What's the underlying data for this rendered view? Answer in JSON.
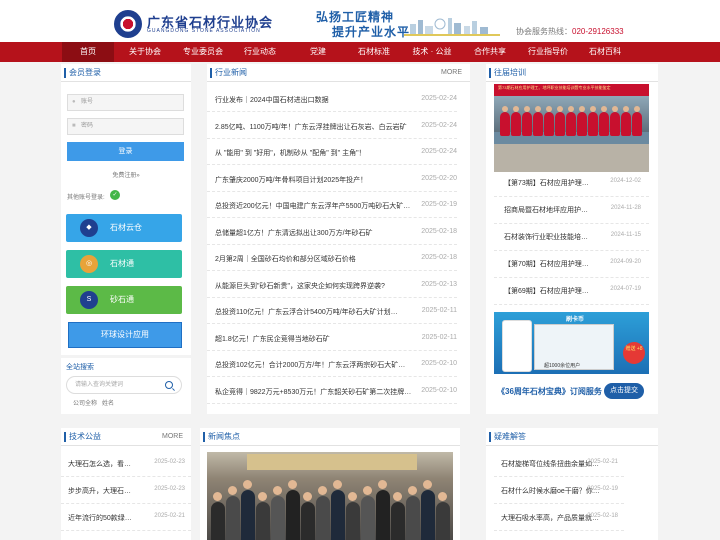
{
  "header": {
    "logo_text": "广东省石材行业协会",
    "logo_sub": "GUANGDONG STONE ASSOCIATION",
    "slogan_1": "弘扬工匠精神",
    "slogan_2": "提升产业水平",
    "hotline_label": "协会服务热线：",
    "hotline_number": "020-29126333"
  },
  "nav": {
    "items": [
      "首页",
      "关于协会",
      "专业委员会",
      "行业动态",
      "党建",
      "石材标准",
      "技术 · 公益",
      "合作共享",
      "行业指导价",
      "石材百科"
    ]
  },
  "login": {
    "title": "会员登录",
    "username_placeholder": "账号",
    "password_placeholder": "密码",
    "login_button": "登录",
    "register": "免费注册»",
    "other_login": "其他账号登录:",
    "wechat_glyph": "✓"
  },
  "apps": {
    "cloud": "石材云仓",
    "tong": "石材通",
    "sand": "砂石通",
    "env": "环球设计应用"
  },
  "site_search": {
    "title": "全站搜索",
    "placeholder": "请输入查询关键词",
    "option_1": "公司全称",
    "option_2": "姓名"
  },
  "industry_news": {
    "title": "行业新闻",
    "more": "MORE",
    "items": [
      {
        "title": "行业发布｜2024中国石材进出口数据",
        "date": "2025-02-24"
      },
      {
        "title": "2.85亿吨、1100万吨/年！广东云浮挂牌出让石灰岩、白云岩矿",
        "date": "2025-02-24"
      },
      {
        "title": "从 \"能用\" 到 \"好用\"，机制砂从 \"配角\" 到\" 主角\"！",
        "date": "2025-02-24"
      },
      {
        "title": "广东肇庆2000万吨/年骨料项目计划2025年投产！",
        "date": "2025-02-20"
      },
      {
        "title": "总投资近200亿元！中国电建广东云浮年产5500万吨砂石大矿…",
        "date": "2025-02-19"
      },
      {
        "title": "总储量超1亿方！广东清远拟出让300万方/年砂石矿",
        "date": "2025-02-18"
      },
      {
        "title": "2月第2周｜全国砂石均价和部分区域砂石价格",
        "date": "2025-02-18"
      },
      {
        "title": "从能源巨头到\"砂石新贵\"，这家央企如何实现跨界逆袭?",
        "date": "2025-02-13"
      },
      {
        "title": "总投资110亿元！广东云浮合计5400万吨/年砂石大矿计划…",
        "date": "2025-02-11"
      },
      {
        "title": "超1.8亿元！广东民企竞得当地砂石矿",
        "date": "2025-02-11"
      },
      {
        "title": "总投资102亿元！合计2000万方/年！广东云浮两宗砂石大矿…",
        "date": "2025-02-10"
      },
      {
        "title": "私企竞得｜9822万元+8530万元！广东韶关砂石矿第二次挂牌…",
        "date": "2025-02-10"
      }
    ]
  },
  "training": {
    "title": "往届培训",
    "photo_banner": "第73期石材应用护理工、地坪职业技能培训暨专业水平技能鉴定",
    "items": [
      {
        "title": "【第73期】石材应用护理…",
        "date": "2024-12-02"
      },
      {
        "title": "招商局暨石材地坪应用护…",
        "date": "2024-11-28"
      },
      {
        "title": "石材装饰行业职业技能培…",
        "date": "2024-11-15"
      },
      {
        "title": "【第70期】石材应用护理…",
        "date": "2024-09-20"
      },
      {
        "title": "【第69期】石材应用护理…",
        "date": "2024-07-19"
      }
    ],
    "ad_badge": "扫码订阅",
    "ad_badge2": "刷卡币",
    "ad_foot": "超1000余位用户",
    "ad_circle": "赠送 +8",
    "order_text": "《36周年石材宝典》订阅服务",
    "order_btn": "点击提交"
  },
  "tech": {
    "title": "技术公益",
    "more": "MORE",
    "items": [
      {
        "title": "大理石怎么选，看…",
        "date": "2025-02-23"
      },
      {
        "title": "步步高升，大理石…",
        "date": "2025-02-23"
      },
      {
        "title": "近年流行的50款绿…",
        "date": "2025-02-21"
      }
    ]
  },
  "focus": {
    "title": "新闻焦点"
  },
  "faq": {
    "title": "疑难解答",
    "items": [
      {
        "title": "石材旋梯弯位线条扭曲余量如…",
        "date": "2025-02-21"
      },
      {
        "title": "石材什么时候水磨oe干磨？你…",
        "date": "2025-02-19"
      },
      {
        "title": "大理石吸水率高，产品质量就…",
        "date": "2025-02-18"
      }
    ]
  },
  "colors": {
    "brand_red": "#b5121b",
    "brand_blue": "#1f5fa8",
    "cloud_btn": "#36a5e8",
    "tong_btn": "#2ebfa5",
    "sand_btn": "#5cba47"
  }
}
